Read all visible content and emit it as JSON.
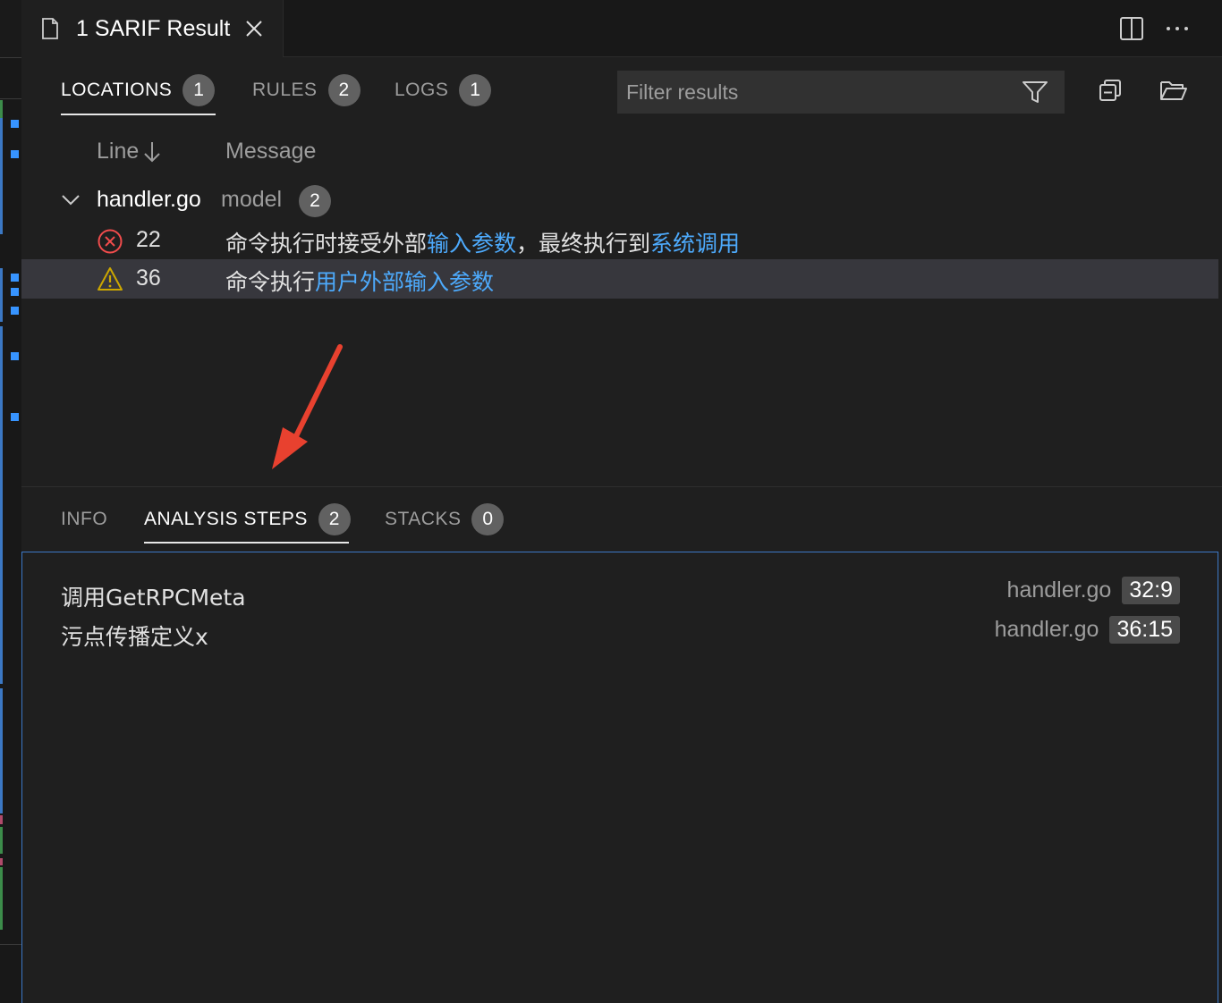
{
  "editor_tab": {
    "title": "1 SARIF Result",
    "icon": "file-icon",
    "close_icon": "close-icon"
  },
  "editor_actions": [
    "split-editor-icon",
    "more-actions-icon"
  ],
  "panel_tabs": [
    {
      "label": "LOCATIONS",
      "count": "1",
      "active": true
    },
    {
      "label": "RULES",
      "count": "2",
      "active": false
    },
    {
      "label": "LOGS",
      "count": "1",
      "active": false
    }
  ],
  "filter": {
    "placeholder": "Filter results",
    "icon": "filter-icon"
  },
  "toolbar_icons": [
    "collapse-all-icon",
    "open-folder-icon"
  ],
  "columns": {
    "line": "Line",
    "message": "Message",
    "sort_icon": "arrow-down-icon"
  },
  "group": {
    "file": "handler.go",
    "folder": "model",
    "count": "2"
  },
  "results": [
    {
      "severity": "error",
      "line": "22",
      "message": [
        {
          "text": "命令执行时接受外部",
          "link": false
        },
        {
          "text": "输入参数",
          "link": true
        },
        {
          "text": "，最终执行到",
          "link": false
        },
        {
          "text": "系统调用",
          "link": true
        }
      ]
    },
    {
      "severity": "warning",
      "line": "36",
      "message": [
        {
          "text": "命令执行",
          "link": false
        },
        {
          "text": "用户外部输入参数",
          "link": true
        }
      ]
    }
  ],
  "detail_tabs": [
    {
      "label": "INFO",
      "count": "",
      "active": false
    },
    {
      "label": "ANALYSIS STEPS",
      "count": "2",
      "active": true
    },
    {
      "label": "STACKS",
      "count": "0",
      "active": false
    }
  ],
  "analysis_steps": [
    {
      "description": "调用GetRPCMeta",
      "file": "handler.go",
      "position": "32:9"
    },
    {
      "description": "污点传播定义x",
      "file": "handler.go",
      "position": "36:15"
    }
  ],
  "colors": {
    "background": "#1f1f1f",
    "link": "#4daafc",
    "error": "#f14c4c",
    "warning": "#cca700",
    "annotation_arrow": "#e8412f",
    "focus_border": "#3c78c6"
  }
}
